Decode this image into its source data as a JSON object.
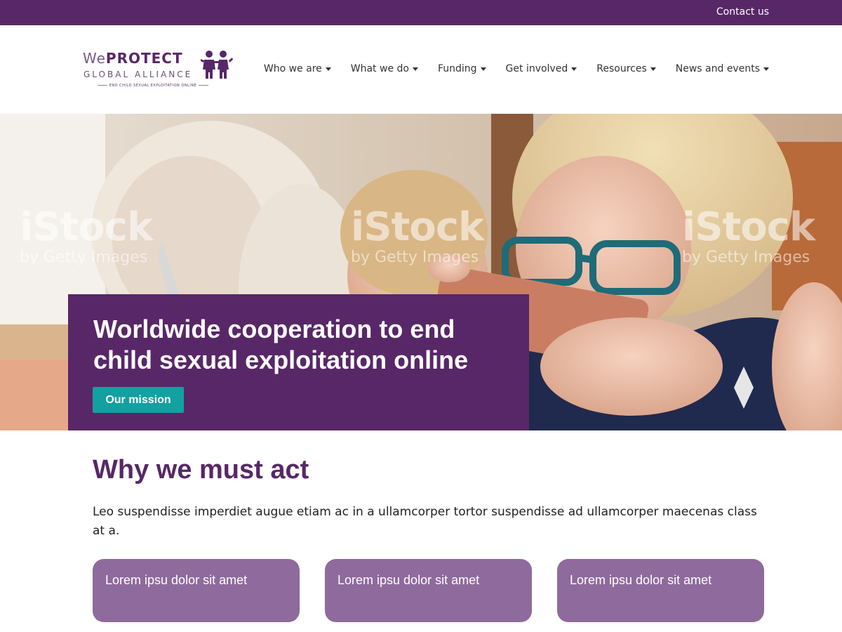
{
  "topbar": {
    "contact_label": "Contact us"
  },
  "logo": {
    "we": "We",
    "protect": "PROTECT",
    "line2": "GLOBAL ALLIANCE",
    "tagline": "END CHILD SEXUAL EXPLOITATION ONLINE"
  },
  "nav": {
    "items": [
      {
        "label": "Who we are"
      },
      {
        "label": "What we do"
      },
      {
        "label": "Funding"
      },
      {
        "label": "Get involved"
      },
      {
        "label": "Resources"
      },
      {
        "label": "News and events"
      }
    ]
  },
  "hero": {
    "title": "Worldwide cooperation to end child sexual exploitation online",
    "button_label": "Our mission",
    "watermark_brand": "iStock",
    "watermark_sub": "by Getty Images"
  },
  "section": {
    "title": "Why we must act",
    "text": "Leo suspendisse imperdiet augue etiam ac in a ullamcorper tortor suspendisse ad ullamcorper maecenas class at a."
  },
  "cards": [
    {
      "label": "Lorem ipsu dolor sit amet"
    },
    {
      "label": "Lorem ipsu dolor sit amet"
    },
    {
      "label": "Lorem ipsu dolor sit amet"
    }
  ],
  "colors": {
    "brand_purple": "#582767",
    "card_purple": "#8f6a9c",
    "button_teal": "#13a0a0"
  }
}
